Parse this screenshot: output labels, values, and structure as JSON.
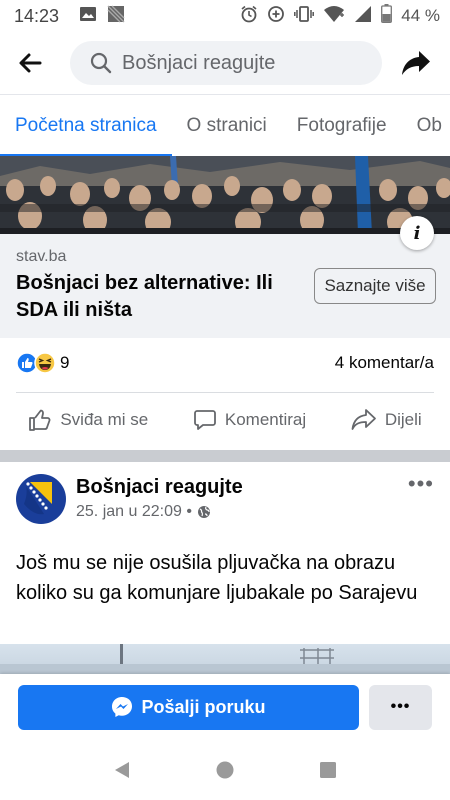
{
  "status_bar": {
    "time": "14:23",
    "battery": "44 %"
  },
  "header": {
    "search_text": "Bošnjaci reagujte"
  },
  "tabs": [
    {
      "label": "Početna stranica",
      "active": true
    },
    {
      "label": "O stranici",
      "active": false
    },
    {
      "label": "Fotografije",
      "active": false
    },
    {
      "label": "Ob",
      "active": false
    }
  ],
  "link_preview": {
    "domain": "stav.ba",
    "title": "Bošnjaci bez alternative: Ili SDA ili ništa",
    "button_label": "Saznajte više",
    "info_icon": "i"
  },
  "reactions": {
    "count": "9",
    "comments": "4 komentar/a"
  },
  "actions": {
    "like": "Sviđa mi se",
    "comment": "Komentiraj",
    "share": "Dijeli"
  },
  "post": {
    "author": "Bošnjaci reagujte",
    "time": "25. jan u 22:09 •",
    "text": "Još mu se nije osušila pljuvačka na obrazu koliko su ga komunjare ljubakale po Sarajevu",
    "more": "•••"
  },
  "bottom_bar": {
    "message_label": "Pošalji poruku",
    "more_label": "•••"
  },
  "colors": {
    "accent": "#1877f2",
    "text_secondary": "#65676b",
    "card_bg": "#f0f2f5"
  }
}
